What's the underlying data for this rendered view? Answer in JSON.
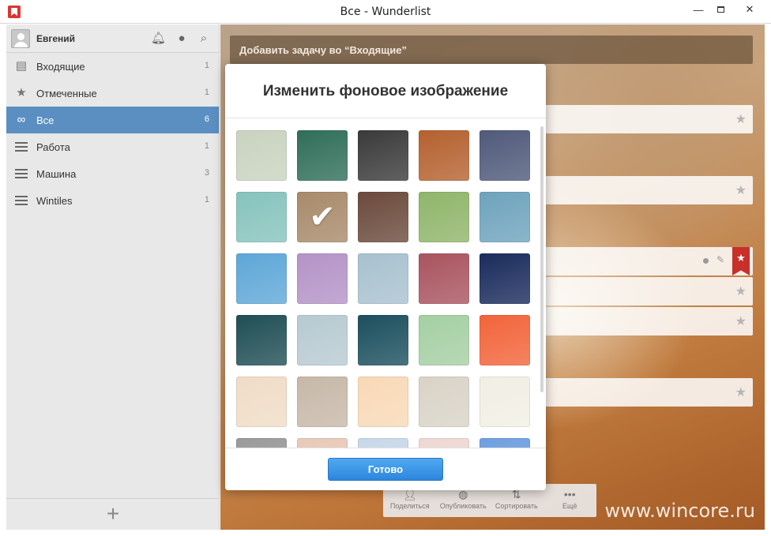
{
  "window": {
    "title": "Все - Wunderlist",
    "minimize": "—",
    "close": "✕"
  },
  "user": {
    "name": "Евгений"
  },
  "sidebar": {
    "items": [
      {
        "label": "Входящие",
        "count": "1",
        "icon": "inbox-icon"
      },
      {
        "label": "Отмеченные",
        "count": "1",
        "icon": "star-icon"
      },
      {
        "label": "Все",
        "count": "6",
        "icon": "infinity-icon"
      },
      {
        "label": "Работа",
        "count": "1",
        "icon": "list-icon"
      },
      {
        "label": "Машина",
        "count": "3",
        "icon": "list-icon"
      },
      {
        "label": "Wintiles",
        "count": "1",
        "icon": "list-icon"
      }
    ],
    "add_symbol": "+"
  },
  "main": {
    "add_task_placeholder": "Добавить задачу во “Входящие”",
    "toolbar": [
      {
        "label": "Поделиться",
        "icon": "share-icon"
      },
      {
        "label": "Опубликовать",
        "icon": "globe-icon"
      },
      {
        "label": "Сортировать",
        "icon": "sort-icon"
      },
      {
        "label": "Ещё",
        "icon": "more-icon"
      }
    ],
    "watermark": "www.wincore.ru"
  },
  "modal": {
    "title": "Изменить фоновое изображение",
    "done_label": "Готово",
    "selected_index": 6,
    "swatches": [
      "#c9d3bf",
      "#2f6e58",
      "#3a3a3a",
      "#b5612f",
      "#4f5a7a",
      "#86c3bd",
      "#a88a6a",
      "#6b4a3c",
      "#8fb56a",
      "#6ea3bd",
      "#5ea7d8",
      "#b493c7",
      "#a8c1cf",
      "#a9545f",
      "#1a2b5c",
      "#1f4e55",
      "#b7cad1",
      "#1b4f5e",
      "#a5cfa3",
      "#f2643a",
      "#f0dcc7",
      "#c7b8a8",
      "#f8d9b6",
      "#d9d3c7",
      "#f1efe4",
      "#9a9a9a",
      "#e8c9b8",
      "#c8d8e8",
      "#eed8d3",
      "#6f9fe0"
    ]
  }
}
